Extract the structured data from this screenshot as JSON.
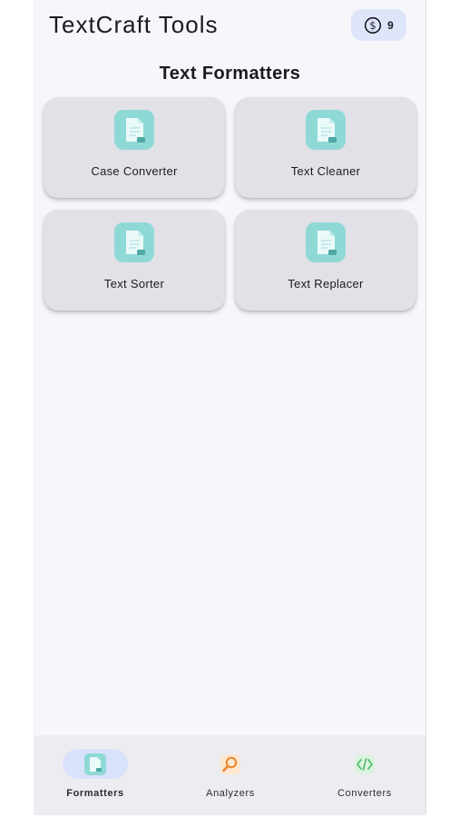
{
  "header": {
    "title": "TextCraft Tools",
    "credits": {
      "icon": "dollar-coin-icon",
      "count": "9"
    }
  },
  "section": {
    "title": "Text Formatters"
  },
  "tools": [
    {
      "label": "Case Converter",
      "icon": "document-icon"
    },
    {
      "label": "Text Cleaner",
      "icon": "document-icon"
    },
    {
      "label": "Text Sorter",
      "icon": "document-icon"
    },
    {
      "label": "Text Replacer",
      "icon": "document-icon"
    }
  ],
  "nav": {
    "active": "Formatters",
    "items": [
      {
        "label": "Formatters",
        "icon": "document-icon"
      },
      {
        "label": "Analyzers",
        "icon": "magnifier-icon"
      },
      {
        "label": "Converters",
        "icon": "code-icon"
      }
    ]
  },
  "colors": {
    "background": "#f7f6fb",
    "card": "#e2e1e8",
    "tool_icon": "#8ed9d5",
    "active_pill": "#d9e2fb",
    "badge": "#dfe5f9",
    "analyzer_icon": "#e8852c",
    "converter_icon": "#4fbf6a"
  }
}
